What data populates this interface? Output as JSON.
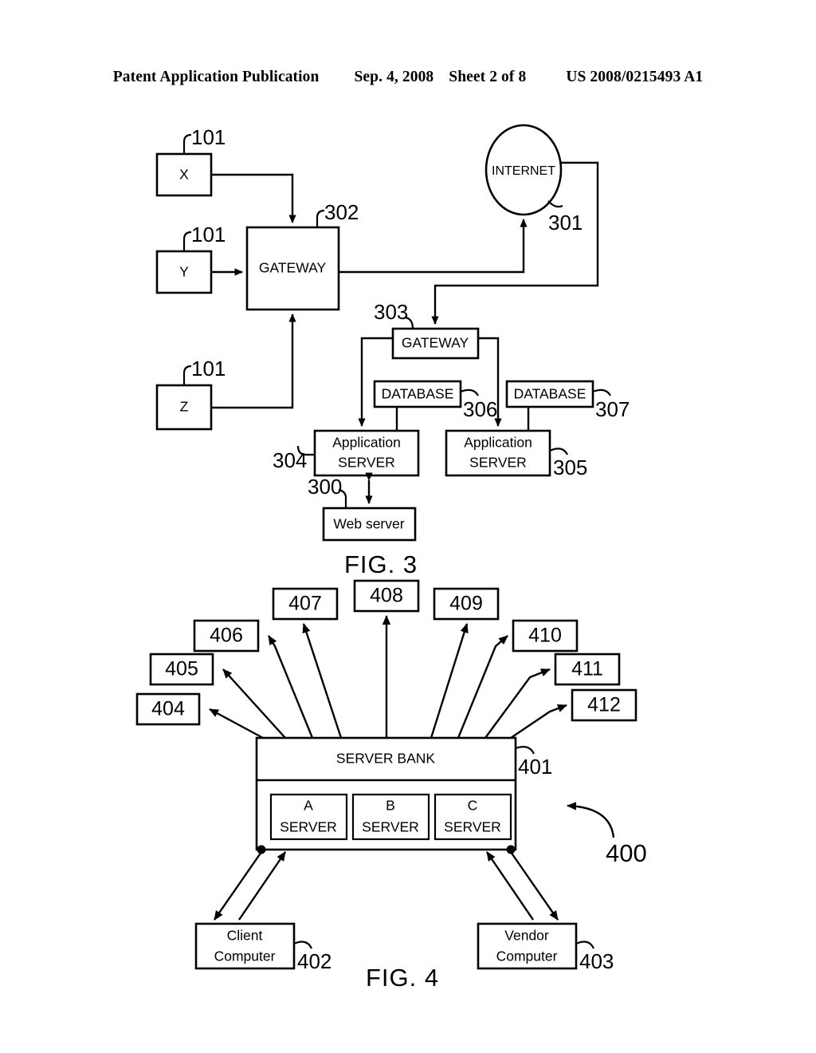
{
  "header": {
    "publication": "Patent Application Publication",
    "date": "Sep. 4, 2008",
    "sheet": "Sheet 2 of 8",
    "doc_number": "US 2008/0215493 A1"
  },
  "figures": [
    {
      "id": "fig3",
      "caption": "FIG. 3",
      "nodes": {
        "client_x": "X",
        "client_y": "Y",
        "client_z": "Z",
        "gateway_302": "GATEWAY",
        "internet": "INTERNET",
        "gateway_303": "GATEWAY",
        "database_306": "DATABASE",
        "database_307": "DATABASE",
        "app_server_304_line1": "Application",
        "app_server_304_line2": "SERVER",
        "app_server_305_line1": "Application",
        "app_server_305_line2": "SERVER",
        "web_server": "Web server"
      },
      "reference_numerals": {
        "client_x": "101",
        "client_y": "101",
        "client_z": "101",
        "gateway_302": "302",
        "internet": "301",
        "gateway_303": "303",
        "database_306": "306",
        "database_307": "307",
        "app_server_304": "304",
        "app_server_305": "305",
        "web_server": "300"
      }
    },
    {
      "id": "fig4",
      "caption": "FIG. 4",
      "nodes": {
        "server_bank": "SERVER BANK",
        "server_a_line1": "A",
        "server_a_line2": "SERVER",
        "server_b_line1": "B",
        "server_b_line2": "SERVER",
        "server_c_line1": "C",
        "server_c_line2": "SERVER",
        "client_computer_line1": "Client",
        "client_computer_line2": "Computer",
        "vendor_computer_line1": "Vendor",
        "vendor_computer_line2": "Computer"
      },
      "reference_numerals": {
        "system": "400",
        "server_bank": "401",
        "client_computer": "402",
        "vendor_computer": "403"
      },
      "peripheral_boxes": [
        "404",
        "405",
        "406",
        "407",
        "408",
        "409",
        "410",
        "411",
        "412"
      ]
    }
  ]
}
